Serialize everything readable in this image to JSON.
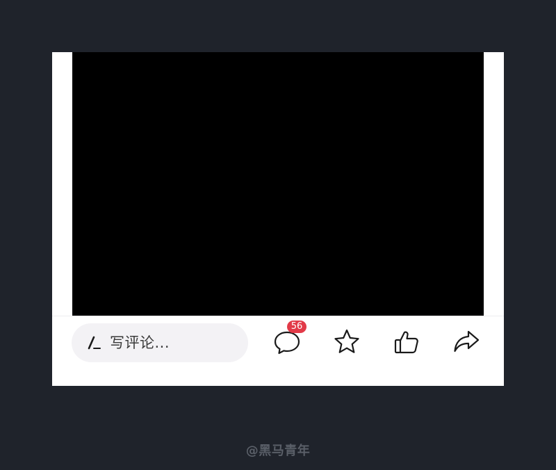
{
  "colors": {
    "background": "#1f232b",
    "video": "#000000",
    "badge": "#e23a48",
    "input_bg": "#f3f2f5"
  },
  "comment_input": {
    "placeholder": "写评论...",
    "icon": "pen-icon"
  },
  "actions": [
    {
      "name": "comment-icon",
      "badge": "56"
    },
    {
      "name": "star-icon"
    },
    {
      "name": "thumbs-up-icon"
    },
    {
      "name": "share-icon"
    }
  ],
  "watermark": "@黑马青年"
}
